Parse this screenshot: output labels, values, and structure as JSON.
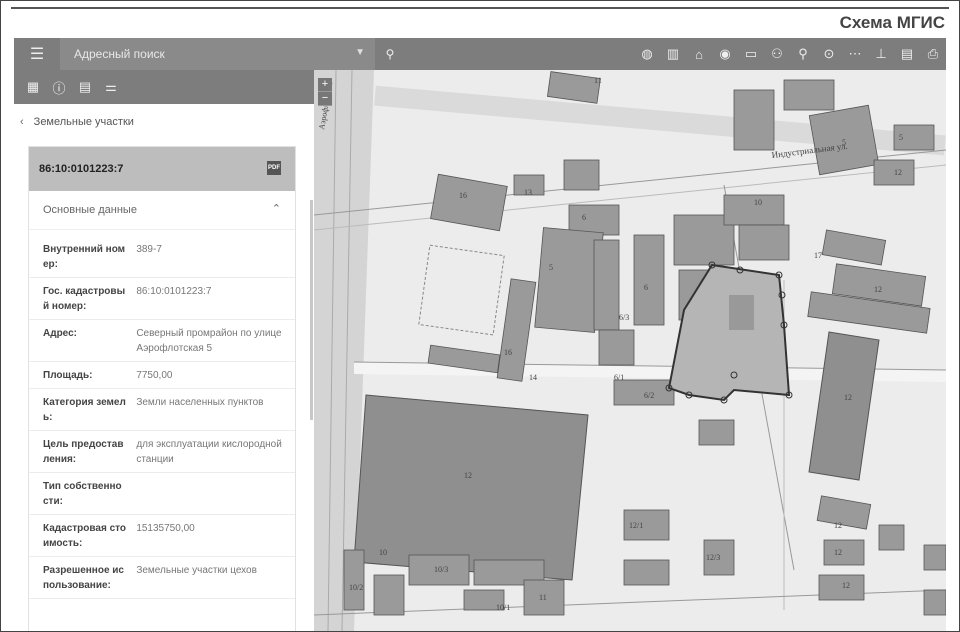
{
  "caption": "Схема МГИС",
  "toolbar": {
    "menu_icon": "menu-icon",
    "search_placeholder": "Адресный поиск",
    "tool_icons": [
      "globe-icon",
      "buildings-icon",
      "home-icon",
      "person-pin-icon",
      "car-icon",
      "people-icon",
      "pin-icon",
      "target-icon",
      "dots-icon",
      "ruler-icon",
      "pdf-icon",
      "print-icon"
    ]
  },
  "side_tabs": [
    "grid-icon",
    "info-icon",
    "list-icon",
    "sliders-icon"
  ],
  "breadcrumb": {
    "label": "Земельные участки"
  },
  "parcel": {
    "id": "86:10:0101223:7",
    "section_title": "Основные данные",
    "rows": [
      {
        "key": "Внутренний номер:",
        "value": "389-7"
      },
      {
        "key": "Гос. кадастровый номер:",
        "value": "86:10:0101223:7"
      },
      {
        "key": "Адрес:",
        "value": "Северный промрайон по улице Аэрофлотская 5"
      },
      {
        "key": "Площадь:",
        "value": "7750,00"
      },
      {
        "key": "Категория земель:",
        "value": "Земли населенных пунктов"
      },
      {
        "key": "Цель предоставления:",
        "value": "для эксплуатации кислородной станции"
      },
      {
        "key": "Тип собственности:",
        "value": ""
      },
      {
        "key": "Кадастровая стоимость:",
        "value": "15135750,00"
      },
      {
        "key": "Разрешенное использование:",
        "value": "Земельные участки цехов"
      }
    ]
  },
  "map": {
    "street_labels": [
      "Индустриальная ул.",
      "Аэрофлотская"
    ],
    "building_labels": [
      "11",
      "5",
      "3",
      "5",
      "5",
      "6",
      "19",
      "17",
      "12",
      "12",
      "12",
      "12",
      "12",
      "12",
      "12",
      "12",
      "12",
      "16",
      "13",
      "14",
      "16",
      "6/3",
      "6/1",
      "6/2",
      "10/2",
      "10",
      "10/3",
      "11",
      "10/1",
      "12/1",
      "12/3"
    ]
  }
}
